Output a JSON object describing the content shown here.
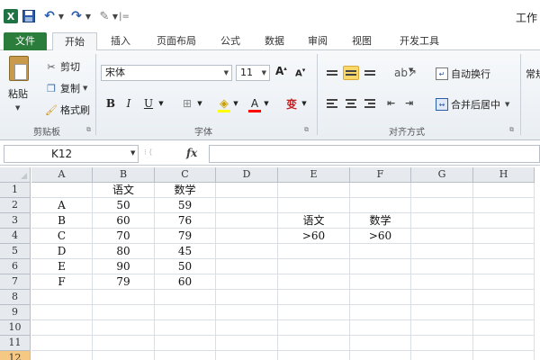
{
  "app": {
    "title_partial": "工作"
  },
  "quick_access": {
    "excel_logo": "X",
    "separator": "|="
  },
  "tabs": [
    {
      "label": "文件"
    },
    {
      "label": "开始"
    },
    {
      "label": "插入"
    },
    {
      "label": "页面布局"
    },
    {
      "label": "公式"
    },
    {
      "label": "数据"
    },
    {
      "label": "审阅"
    },
    {
      "label": "视图"
    },
    {
      "label": "开发工具"
    }
  ],
  "ribbon": {
    "clipboard": {
      "paste_label": "粘贴",
      "cut_label": "剪切",
      "copy_label": "复制",
      "format_painter_label": "格式刷",
      "group_label": "剪贴板"
    },
    "font": {
      "font_name": "宋体",
      "font_size": "11",
      "grow_label": "A",
      "shrink_label": "A",
      "bold_label": "B",
      "italic_label": "I",
      "underline_label": "U",
      "font_color_label": "A",
      "phonetic_label": "变",
      "group_label": "字体"
    },
    "alignment": {
      "wrap_label": "自动换行",
      "merge_label": "合并后居中",
      "group_label": "对齐方式"
    },
    "number": {
      "label_partial": "常规"
    }
  },
  "formula_bar": {
    "name_box": "K12",
    "fx_label": "fx",
    "formula": ""
  },
  "sheet": {
    "columns": [
      "A",
      "B",
      "C",
      "D",
      "E",
      "F",
      "G",
      "H"
    ],
    "rows": [
      "1",
      "2",
      "3",
      "4",
      "5",
      "6",
      "7",
      "8",
      "9",
      "10",
      "11",
      "12"
    ],
    "cells": {
      "B1": "语文",
      "C1": "数学",
      "A2": "A",
      "B2": "50",
      "C2": "59",
      "A3": "B",
      "B3": "60",
      "C3": "76",
      "E3": "语文",
      "F3": "数学",
      "A4": "C",
      "B4": "70",
      "C4": "79",
      "E4": ">60",
      "F4": ">60",
      "A5": "D",
      "B5": "80",
      "C5": "45",
      "A6": "E",
      "B6": "90",
      "C6": "50",
      "A7": "F",
      "B7": "79",
      "C7": "60"
    },
    "selected_cell": "K12"
  }
}
